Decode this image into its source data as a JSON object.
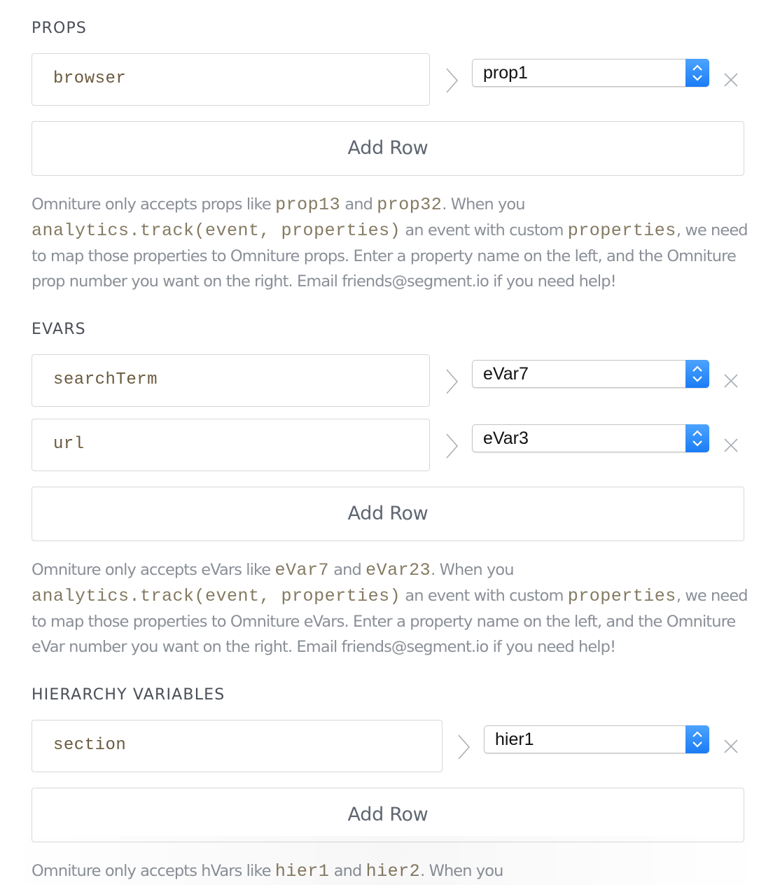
{
  "props": {
    "title": "PROPS",
    "rows": [
      {
        "key": "browser",
        "value": "prop1"
      }
    ],
    "add_row_label": "Add Row",
    "help": {
      "t1": "Omniture only accepts props like ",
      "c1": "prop13",
      "t2": " and ",
      "c2": "prop32",
      "t3": ". When you ",
      "c3": "analytics.track(event, properties)",
      "t4": " an event with custom ",
      "c4": "properties",
      "t5": ", we need to map those properties to Omniture props. Enter a property name on the left, and the Omniture prop number you want on the right. Email friends@segment.io if you need help!"
    }
  },
  "evars": {
    "title": "EVARS",
    "rows": [
      {
        "key": "searchTerm",
        "value": "eVar7"
      },
      {
        "key": "url",
        "value": "eVar3"
      }
    ],
    "add_row_label": "Add Row",
    "help": {
      "t1": "Omniture only accepts eVars like ",
      "c1": "eVar7",
      "t2": " and ",
      "c2": "eVar23",
      "t3": ". When you ",
      "c3": "analytics.track(event, properties)",
      "t4": " an event with custom ",
      "c4": "properties",
      "t5": ", we need to map those properties to Omniture eVars. Enter a property name on the left, and the Omniture eVar number you want on the right. Email friends@segment.io if you need help!"
    }
  },
  "hierarchy": {
    "title": "HIERARCHY VARIABLES",
    "rows": [
      {
        "key": "section",
        "value": "hier1"
      }
    ],
    "add_row_label": "Add Row",
    "help": {
      "t1": "Omniture only accepts hVars like ",
      "c1": "hier1",
      "t2": " and ",
      "c2": "hier2",
      "t3": ". When you"
    }
  },
  "colors": {
    "stepper_blue": "#1a7cf5",
    "mono_text": "#6b5a3e",
    "help_text": "#8a8f97"
  },
  "icons": {
    "arrow": "chevron-right-icon",
    "remove": "close-icon",
    "select_stepper": "up-down-stepper-icon"
  }
}
